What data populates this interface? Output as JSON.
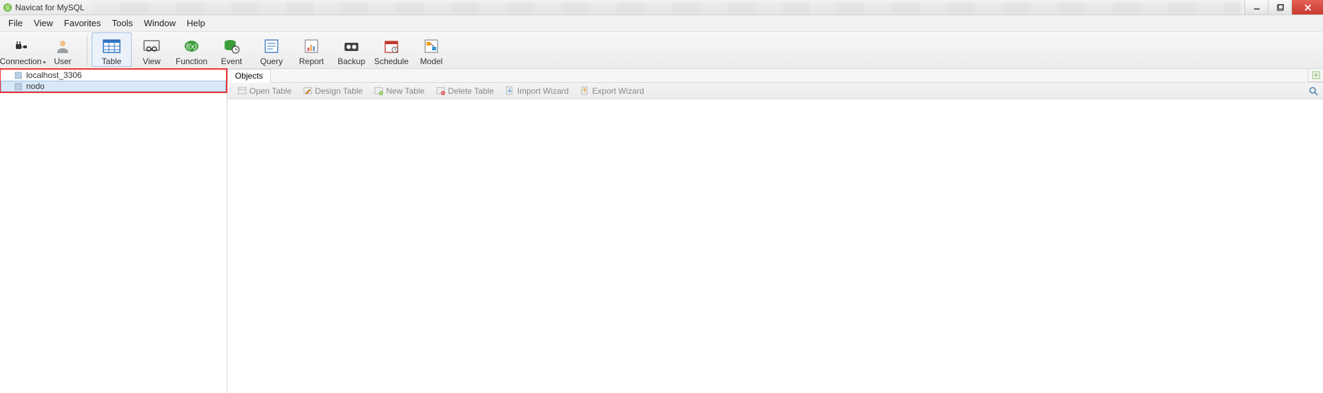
{
  "titlebar": {
    "app_name": "Navicat for MySQL",
    "icon_name": "navicat-icon"
  },
  "window_controls": {
    "minimize": "minimize-icon",
    "maximize": "maximize-icon",
    "close": "close-icon"
  },
  "menu": {
    "items": [
      "File",
      "View",
      "Favorites",
      "Tools",
      "Window",
      "Help"
    ]
  },
  "toolbar": {
    "items": [
      {
        "label": "Connection",
        "icon": "plug-icon",
        "has_dropdown": true
      },
      {
        "label": "User",
        "icon": "user-icon"
      },
      {
        "label": "Table",
        "icon": "table-grid-icon",
        "active": true
      },
      {
        "label": "View",
        "icon": "view-glasses-icon"
      },
      {
        "label": "Function",
        "icon": "function-fx-icon"
      },
      {
        "label": "Event",
        "icon": "event-clock-icon"
      },
      {
        "label": "Query",
        "icon": "query-sheet-icon"
      },
      {
        "label": "Report",
        "icon": "report-chart-icon"
      },
      {
        "label": "Backup",
        "icon": "backup-tape-icon"
      },
      {
        "label": "Schedule",
        "icon": "schedule-calendar-icon"
      },
      {
        "label": "Model",
        "icon": "model-diagram-icon"
      }
    ]
  },
  "sidebar": {
    "connections": [
      {
        "name": "localhost_3306",
        "selected": false
      },
      {
        "name": "nodo",
        "selected": true
      }
    ]
  },
  "tabs": {
    "active": "Objects"
  },
  "subtoolbar": {
    "items": [
      {
        "label": "Open Table",
        "icon": "open-table-icon"
      },
      {
        "label": "Design Table",
        "icon": "design-table-icon"
      },
      {
        "label": "New Table",
        "icon": "new-table-icon"
      },
      {
        "label": "Delete Table",
        "icon": "delete-table-icon"
      },
      {
        "label": "Import Wizard",
        "icon": "import-wizard-icon"
      },
      {
        "label": "Export Wizard",
        "icon": "export-wizard-icon"
      }
    ]
  },
  "colors": {
    "accent": "#2f74c0",
    "highlight_red": "#e33333",
    "selection": "#d9e8f7"
  }
}
